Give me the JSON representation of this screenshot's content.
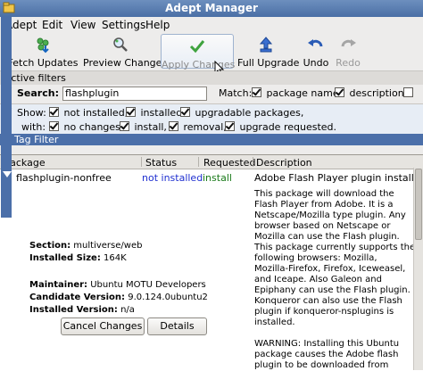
{
  "window": {
    "title": "Adept Manager"
  },
  "menu": [
    "Adept",
    "Edit",
    "View",
    "Settings",
    "Help"
  ],
  "toolbar": {
    "fetch": "Fetch Updates",
    "preview": "Preview Changes",
    "apply": "Apply Changes",
    "full": "Full Upgrade",
    "undo": "Undo",
    "redo": "Redo"
  },
  "filters": {
    "header": "Active filters",
    "search_label": "Search:",
    "search_value": "flashplugin",
    "match_label": "Match:",
    "match_opts": [
      "package name,",
      "description,"
    ],
    "show_label": "Show:",
    "show_opts": [
      "not installed,",
      "installed,",
      "upgradable packages,"
    ],
    "with_label": "with:",
    "with_opts": [
      "no changes,",
      "install,",
      "removal,",
      "upgrade requested."
    ]
  },
  "tag_filter": "Tag Filter",
  "table": {
    "columns": [
      "Package",
      "Status",
      "Requested",
      "Description"
    ],
    "row": {
      "package": "flashplugin-nonfree",
      "status": "not installed",
      "requested": "install",
      "summary": "Adobe Flash Player plugin installer"
    }
  },
  "details": {
    "section_label": "Section:",
    "section": "multiverse/web",
    "size_label": "Installed Size:",
    "size": "164K",
    "maint_label": "Maintainer:",
    "maint": "Ubuntu MOTU Developers",
    "cand_label": "Candidate Version:",
    "cand": "9.0.124.0ubuntu2",
    "inst_label": "Installed Version:",
    "inst": "n/a",
    "cancel_btn": "Cancel Changes",
    "details_btn": "Details"
  },
  "description_lines": [
    "This package will download the",
    "Flash Player from Adobe. It is a",
    "Netscape/Mozilla type plugin. Any",
    "browser based on Netscape or",
    "Mozilla can use the Flash plugin.",
    "This package currently supports the",
    "following browsers: Mozilla,",
    "Mozilla-Firefox, Firefox, Iceweasel,",
    "and Iceape. Also Galeon and",
    "Epiphany can use the Flash plugin.",
    "Konqueror can also use the Flash",
    "plugin if konqueror-nsplugins is",
    "installed.",
    "",
    "WARNING: Installing this Ubuntu",
    "package causes the Adobe flash",
    "plugin to be downloaded from"
  ],
  "colors": {
    "title_bar": "#4a6fa5",
    "accent_blue": "#2c62c9",
    "status_blue": "#1f2fd0",
    "install_green": "#1a7a1a"
  }
}
